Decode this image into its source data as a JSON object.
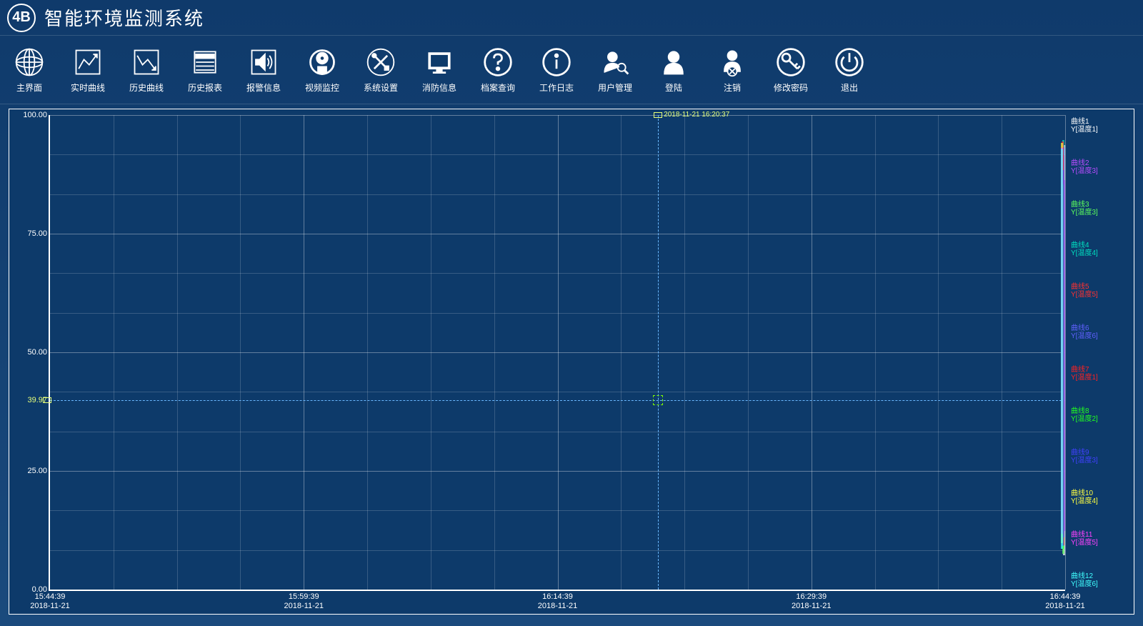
{
  "header": {
    "logo_text": "4B",
    "title": "智能环境监测系统"
  },
  "toolbar": [
    {
      "id": "main",
      "label": "主界面",
      "icon": "globe"
    },
    {
      "id": "realtime",
      "label": "实时曲线",
      "icon": "chart-up"
    },
    {
      "id": "history-curve",
      "label": "历史曲线",
      "icon": "chart-down"
    },
    {
      "id": "history-report",
      "label": "历史报表",
      "icon": "report"
    },
    {
      "id": "alarm",
      "label": "报警信息",
      "icon": "speaker"
    },
    {
      "id": "video",
      "label": "视频监控",
      "icon": "camera"
    },
    {
      "id": "settings",
      "label": "系统设置",
      "icon": "tools"
    },
    {
      "id": "fire",
      "label": "消防信息",
      "icon": "monitor"
    },
    {
      "id": "archive",
      "label": "档案查询",
      "icon": "question"
    },
    {
      "id": "worklog",
      "label": "工作日志",
      "icon": "info"
    },
    {
      "id": "user-mgmt",
      "label": "用户管理",
      "icon": "user-search"
    },
    {
      "id": "login",
      "label": "登陆",
      "icon": "user"
    },
    {
      "id": "logout",
      "label": "注销",
      "icon": "user-x"
    },
    {
      "id": "password",
      "label": "修改密码",
      "icon": "key"
    },
    {
      "id": "exit",
      "label": "退出",
      "icon": "power"
    }
  ],
  "chart_data": {
    "type": "line",
    "title": "",
    "ylim": [
      0,
      100
    ],
    "y_ticks": [
      0.0,
      25.0,
      50.0,
      75.0,
      100.0
    ],
    "x_ticks": [
      {
        "time": "15:44:39",
        "date": "2018-11-21"
      },
      {
        "time": "15:59:39",
        "date": "2018-11-21"
      },
      {
        "time": "16:14:39",
        "date": "2018-11-21"
      },
      {
        "time": "16:29:39",
        "date": "2018-11-21"
      },
      {
        "time": "16:44:39",
        "date": "2018-11-21"
      }
    ],
    "cursor": {
      "timestamp": "2018-11-21 16:20:37",
      "x_fraction": 0.599,
      "y_value": 39.97,
      "y_fraction": 0.3997
    },
    "series": [
      {
        "name": "曲线1",
        "var": "Y[温度1]",
        "color": "#ffffff"
      },
      {
        "name": "曲线2",
        "var": "Y[温度3]",
        "color": "#b84cff"
      },
      {
        "name": "曲线3",
        "var": "Y[温度3]",
        "color": "#5cff5c"
      },
      {
        "name": "曲线4",
        "var": "Y[温度4]",
        "color": "#00e0c0"
      },
      {
        "name": "曲线5",
        "var": "Y[温度5]",
        "color": "#ff3030"
      },
      {
        "name": "曲线6",
        "var": "Y[温度6]",
        "color": "#6060ff"
      },
      {
        "name": "曲线7",
        "var": "Y[温度1]",
        "color": "#ff2020"
      },
      {
        "name": "曲线8",
        "var": "Y[温度2]",
        "color": "#20ff20"
      },
      {
        "name": "曲线9",
        "var": "Y[温度3]",
        "color": "#4040ff"
      },
      {
        "name": "曲线10",
        "var": "Y[温度4]",
        "color": "#ffff40"
      },
      {
        "name": "曲线11",
        "var": "Y[温度5]",
        "color": "#ff40ff"
      },
      {
        "name": "曲线12",
        "var": "Y[温度6]",
        "color": "#40ffff"
      }
    ]
  }
}
